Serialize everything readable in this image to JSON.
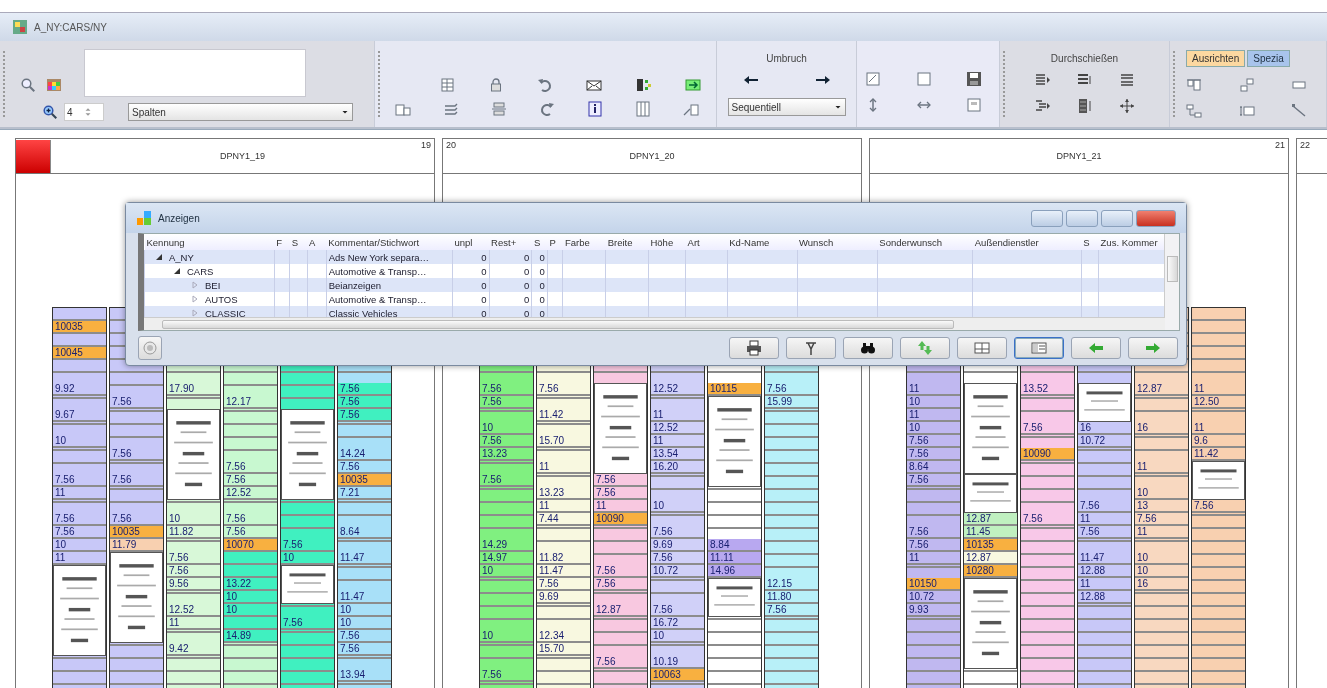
{
  "window": {
    "title": "A_NY:CARS/NY"
  },
  "ribbon": {
    "zoom_value": "4",
    "view_select": "Spalten",
    "break_label": "Umbruch",
    "break_select": "Sequentiell",
    "interleave_label": "Durchschießen",
    "tabs": [
      {
        "label": "Ausrichten",
        "selected": true
      },
      {
        "label": "Spezia",
        "selected": false
      }
    ]
  },
  "pages": [
    {
      "title": "DPNY1_19",
      "number": "19",
      "flagged": true,
      "columns": [
        {
          "color": "#c8c8f8",
          "head": [
            {
              "kind": "strip"
            },
            {
              "kind": "strip",
              "color": "#f8b040",
              "label": "10035"
            },
            {
              "kind": "strip"
            },
            {
              "kind": "strip",
              "color": "#f8b040",
              "label": "10045"
            },
            {
              "kind": "strip"
            }
          ],
          "blocks": [
            {
              "kind": "strip",
              "label": "9.92"
            },
            {
              "kind": "strip"
            },
            {
              "kind": "strip",
              "label": "9.67"
            },
            {
              "kind": "strip"
            },
            {
              "kind": "strip",
              "label": "10"
            },
            {
              "kind": "strip"
            },
            {
              "kind": "strip"
            },
            {
              "kind": "strip",
              "label": "7.56"
            },
            {
              "kind": "strip",
              "label": "11"
            },
            {
              "kind": "strip"
            },
            {
              "kind": "strip",
              "label": "7.56"
            },
            {
              "kind": "strip",
              "label": "7.56"
            },
            {
              "kind": "strip",
              "label": "10"
            },
            {
              "kind": "strip",
              "label": "11"
            },
            {
              "kind": "ad"
            }
          ]
        },
        {
          "color": "#c8c8f8",
          "blocks": [
            {
              "kind": "strip"
            },
            {
              "kind": "strip",
              "label": "7.56"
            },
            {
              "kind": "strip"
            },
            {
              "kind": "strip"
            },
            {
              "kind": "strip"
            },
            {
              "kind": "strip",
              "label": "7.56"
            },
            {
              "kind": "strip"
            },
            {
              "kind": "strip",
              "label": "7.56"
            },
            {
              "kind": "strip"
            },
            {
              "kind": "strip"
            },
            {
              "kind": "strip",
              "label": "7.56"
            },
            {
              "kind": "strip",
              "color": "#f8b040",
              "label": "10035"
            },
            {
              "kind": "strip",
              "color": "#f8d0b0",
              "label": "11.79"
            },
            {
              "kind": "ad"
            }
          ]
        },
        {
          "color": "#d8f8d8",
          "blocks": [
            {
              "kind": "strip",
              "label": "17.90"
            },
            {
              "kind": "strip"
            },
            {
              "kind": "ad"
            },
            {
              "kind": "strip"
            },
            {
              "kind": "strip",
              "label": "10"
            },
            {
              "kind": "strip",
              "label": "11.82"
            },
            {
              "kind": "strip"
            },
            {
              "kind": "strip",
              "label": "7.56"
            },
            {
              "kind": "strip",
              "label": "7.56"
            },
            {
              "kind": "strip",
              "label": "9.56"
            },
            {
              "kind": "strip"
            },
            {
              "kind": "strip",
              "label": "12.52"
            },
            {
              "kind": "strip",
              "label": "11"
            },
            {
              "kind": "strip"
            },
            {
              "kind": "strip",
              "label": "9.42"
            }
          ]
        },
        {
          "color": "#c8f8d0",
          "blocks": [
            {
              "kind": "strip"
            },
            {
              "kind": "strip",
              "label": "12.17"
            },
            {
              "kind": "strip"
            },
            {
              "kind": "strip"
            },
            {
              "kind": "strip"
            },
            {
              "kind": "strip"
            },
            {
              "kind": "strip",
              "label": "7.56"
            },
            {
              "kind": "strip",
              "label": "7.56"
            },
            {
              "kind": "strip",
              "label": "12.52"
            },
            {
              "kind": "strip"
            },
            {
              "kind": "strip",
              "label": "7.56"
            },
            {
              "kind": "strip",
              "label": "7.56"
            },
            {
              "kind": "strip",
              "color": "#f8b040",
              "label": "10070"
            },
            {
              "kind": "strip",
              "color": "#40f0c0"
            },
            {
              "kind": "strip",
              "color": "#40f0c0"
            },
            {
              "kind": "strip",
              "color": "#40f0c0",
              "label": "13.22"
            },
            {
              "kind": "strip",
              "color": "#40f0c0",
              "label": "10"
            },
            {
              "kind": "strip",
              "color": "#40f0c0",
              "label": "10"
            },
            {
              "kind": "strip",
              "color": "#40f0c0"
            },
            {
              "kind": "strip",
              "color": "#40f0c0",
              "label": "14.89"
            }
          ]
        },
        {
          "color": "#40f0c0",
          "blocks": [
            {
              "kind": "strip"
            },
            {
              "kind": "strip"
            },
            {
              "kind": "ad"
            },
            {
              "kind": "strip"
            },
            {
              "kind": "strip"
            },
            {
              "kind": "strip"
            },
            {
              "kind": "strip",
              "label": "7.56"
            },
            {
              "kind": "strip",
              "label": "10"
            },
            {
              "kind": "note"
            },
            {
              "kind": "strip"
            },
            {
              "kind": "strip",
              "label": "7.56"
            },
            {
              "kind": "strip"
            }
          ]
        },
        {
          "color": "#a8e0f8",
          "blocks": [
            {
              "kind": "strip",
              "color": "#40f0c0",
              "label": "7.56"
            },
            {
              "kind": "strip",
              "color": "#40f0c0",
              "label": "7.56"
            },
            {
              "kind": "strip",
              "color": "#40f0c0",
              "label": "7.56"
            },
            {
              "kind": "strip"
            },
            {
              "kind": "strip"
            },
            {
              "kind": "strip",
              "label": "14.24"
            },
            {
              "kind": "strip",
              "label": "7.56"
            },
            {
              "kind": "strip",
              "color": "#f8b040",
              "label": "10035"
            },
            {
              "kind": "strip",
              "label": "7.21"
            },
            {
              "kind": "strip"
            },
            {
              "kind": "strip"
            },
            {
              "kind": "strip",
              "label": "8.64"
            },
            {
              "kind": "strip"
            },
            {
              "kind": "strip",
              "label": "11.47"
            },
            {
              "kind": "strip"
            },
            {
              "kind": "strip"
            },
            {
              "kind": "strip",
              "label": "11.47"
            },
            {
              "kind": "strip",
              "label": "10"
            },
            {
              "kind": "strip",
              "label": "10"
            },
            {
              "kind": "strip",
              "label": "7.56"
            },
            {
              "kind": "strip",
              "label": "7.56"
            },
            {
              "kind": "strip"
            },
            {
              "kind": "strip",
              "label": "13.94"
            }
          ]
        }
      ]
    },
    {
      "title": "DPNY1_20",
      "number": "20",
      "flagged": false,
      "columns": [
        {
          "color": "#80f080",
          "blocks": [
            {
              "kind": "strip",
              "label": "7.56"
            },
            {
              "kind": "strip",
              "label": "7.56"
            },
            {
              "kind": "strip"
            },
            {
              "kind": "strip",
              "label": "10"
            },
            {
              "kind": "strip",
              "label": "7.56"
            },
            {
              "kind": "strip",
              "label": "13.23"
            },
            {
              "kind": "strip"
            },
            {
              "kind": "strip",
              "label": "7.56"
            },
            {
              "kind": "strip"
            },
            {
              "kind": "strip"
            },
            {
              "kind": "strip"
            },
            {
              "kind": "strip"
            },
            {
              "kind": "strip",
              "label": "14.29"
            },
            {
              "kind": "strip",
              "label": "14.97"
            },
            {
              "kind": "strip",
              "label": "10"
            },
            {
              "kind": "strip"
            },
            {
              "kind": "strip"
            },
            {
              "kind": "strip"
            },
            {
              "kind": "strip"
            },
            {
              "kind": "strip",
              "label": "10"
            },
            {
              "kind": "strip"
            },
            {
              "kind": "strip"
            },
            {
              "kind": "strip",
              "label": "7.56"
            }
          ]
        },
        {
          "color": "#f8f8e0",
          "blocks": [
            {
              "kind": "strip",
              "label": "7.56"
            },
            {
              "kind": "strip"
            },
            {
              "kind": "strip",
              "label": "11.42"
            },
            {
              "kind": "strip"
            },
            {
              "kind": "strip",
              "label": "15.70"
            },
            {
              "kind": "strip"
            },
            {
              "kind": "strip",
              "label": "11"
            },
            {
              "kind": "strip"
            },
            {
              "kind": "strip",
              "label": "13.23"
            },
            {
              "kind": "strip",
              "label": "11"
            },
            {
              "kind": "strip",
              "label": "7.44"
            },
            {
              "kind": "strip"
            },
            {
              "kind": "strip"
            },
            {
              "kind": "strip",
              "label": "11.82"
            },
            {
              "kind": "strip",
              "label": "11.47"
            },
            {
              "kind": "strip",
              "label": "7.56"
            },
            {
              "kind": "strip",
              "label": "9.69"
            },
            {
              "kind": "strip"
            },
            {
              "kind": "strip"
            },
            {
              "kind": "strip",
              "label": "12.34"
            },
            {
              "kind": "strip",
              "label": "15.70"
            }
          ]
        },
        {
          "color": "#f8c8e0",
          "blocks": [
            {
              "kind": "ad"
            },
            {
              "kind": "strip",
              "label": "7.56"
            },
            {
              "kind": "strip",
              "label": "7.56"
            },
            {
              "kind": "strip",
              "label": "11"
            },
            {
              "kind": "strip",
              "color": "#f8b040",
              "label": "10090"
            },
            {
              "kind": "strip"
            },
            {
              "kind": "strip"
            },
            {
              "kind": "strip"
            },
            {
              "kind": "strip",
              "label": "7.56"
            },
            {
              "kind": "strip",
              "label": "7.56"
            },
            {
              "kind": "strip"
            },
            {
              "kind": "strip",
              "label": "12.87"
            },
            {
              "kind": "strip"
            },
            {
              "kind": "strip"
            },
            {
              "kind": "strip"
            },
            {
              "kind": "strip",
              "label": "7.56"
            }
          ]
        },
        {
          "color": "#d0d0f8",
          "blocks": [
            {
              "kind": "strip",
              "label": "12.52"
            },
            {
              "kind": "strip"
            },
            {
              "kind": "strip",
              "label": "11"
            },
            {
              "kind": "strip",
              "label": "12.52"
            },
            {
              "kind": "strip",
              "label": "11"
            },
            {
              "kind": "strip",
              "label": "13.54"
            },
            {
              "kind": "strip",
              "label": "16.20"
            },
            {
              "kind": "strip"
            },
            {
              "kind": "strip"
            },
            {
              "kind": "strip",
              "label": "10"
            },
            {
              "kind": "strip"
            },
            {
              "kind": "strip",
              "label": "7.56"
            },
            {
              "kind": "strip",
              "label": "9.69"
            },
            {
              "kind": "strip",
              "label": "7.56"
            },
            {
              "kind": "strip",
              "label": "10.72"
            },
            {
              "kind": "strip"
            },
            {
              "kind": "strip"
            },
            {
              "kind": "strip",
              "label": "7.56"
            },
            {
              "kind": "strip",
              "label": "16.72"
            },
            {
              "kind": "strip",
              "label": "10"
            },
            {
              "kind": "strip"
            },
            {
              "kind": "strip",
              "label": "10.19"
            },
            {
              "kind": "strip",
              "color": "#f8b040",
              "label": "10063"
            }
          ]
        },
        {
          "color": "#ffffff",
          "blocks": [
            {
              "kind": "strip",
              "color": "#f8b040",
              "label": "10115"
            },
            {
              "kind": "ad"
            },
            {
              "kind": "strip"
            },
            {
              "kind": "strip"
            },
            {
              "kind": "strip"
            },
            {
              "kind": "strip"
            },
            {
              "kind": "strip",
              "color": "#b8a8f0",
              "label": "8.84"
            },
            {
              "kind": "strip",
              "color": "#b8a8f0",
              "label": "11.11"
            },
            {
              "kind": "strip",
              "color": "#b8a8f0",
              "label": "14.96"
            },
            {
              "kind": "note"
            }
          ]
        },
        {
          "color": "#b8f0f8",
          "blocks": [
            {
              "kind": "strip",
              "label": "7.56"
            },
            {
              "kind": "strip",
              "label": "15.99"
            },
            {
              "kind": "strip"
            },
            {
              "kind": "strip"
            },
            {
              "kind": "strip"
            },
            {
              "kind": "strip"
            },
            {
              "kind": "strip"
            },
            {
              "kind": "strip"
            },
            {
              "kind": "strip"
            },
            {
              "kind": "strip"
            },
            {
              "kind": "strip"
            },
            {
              "kind": "strip"
            },
            {
              "kind": "strip"
            },
            {
              "kind": "strip"
            },
            {
              "kind": "strip"
            },
            {
              "kind": "strip",
              "label": "12.15"
            },
            {
              "kind": "strip",
              "label": "11.80"
            },
            {
              "kind": "strip",
              "label": "7.56"
            }
          ]
        }
      ]
    },
    {
      "title": "DPNY1_21",
      "number": "21",
      "flagged": false,
      "columns": [
        {
          "color": "#c0b8f0",
          "blocks": [
            {
              "kind": "strip",
              "label": "11"
            },
            {
              "kind": "strip",
              "label": "10"
            },
            {
              "kind": "strip",
              "label": "11"
            },
            {
              "kind": "strip",
              "label": "10"
            },
            {
              "kind": "strip",
              "label": "7.56"
            },
            {
              "kind": "strip",
              "label": "7.56"
            },
            {
              "kind": "strip",
              "label": "8.64"
            },
            {
              "kind": "strip",
              "label": "7.56"
            },
            {
              "kind": "strip"
            },
            {
              "kind": "strip"
            },
            {
              "kind": "strip"
            },
            {
              "kind": "strip",
              "label": "7.56"
            },
            {
              "kind": "strip",
              "label": "7.56"
            },
            {
              "kind": "strip",
              "label": "11"
            },
            {
              "kind": "strip"
            },
            {
              "kind": "strip",
              "color": "#f8b040",
              "label": "10150"
            },
            {
              "kind": "strip",
              "label": "10.72"
            },
            {
              "kind": "strip",
              "label": "9.93"
            }
          ]
        },
        {
          "color": "#ffffff",
          "blocks": [
            {
              "kind": "ad"
            },
            {
              "kind": "note"
            },
            {
              "kind": "strip",
              "color": "#c0f0c0",
              "label": "12.87"
            },
            {
              "kind": "strip",
              "color": "#c0f0c0",
              "label": "11.45"
            },
            {
              "kind": "strip",
              "color": "#f8b040",
              "label": "10135"
            },
            {
              "kind": "strip",
              "color": "#f8f8e0",
              "label": "12.87"
            },
            {
              "kind": "strip",
              "color": "#f8b040",
              "label": "10280"
            },
            {
              "kind": "ad"
            }
          ]
        },
        {
          "color": "#f8c8e8",
          "blocks": [
            {
              "kind": "strip",
              "label": "13.52"
            },
            {
              "kind": "strip"
            },
            {
              "kind": "strip"
            },
            {
              "kind": "strip",
              "label": "7.56"
            },
            {
              "kind": "strip"
            },
            {
              "kind": "strip",
              "color": "#f8b040",
              "label": "10090"
            },
            {
              "kind": "strip"
            },
            {
              "kind": "strip"
            },
            {
              "kind": "strip"
            },
            {
              "kind": "strip"
            },
            {
              "kind": "strip",
              "label": "7.56"
            },
            {
              "kind": "strip"
            },
            {
              "kind": "strip"
            },
            {
              "kind": "strip"
            }
          ]
        },
        {
          "color": "#c8c8f8",
          "blocks": [
            {
              "kind": "note"
            },
            {
              "kind": "strip",
              "label": "16"
            },
            {
              "kind": "strip",
              "label": "10.72"
            },
            {
              "kind": "strip"
            },
            {
              "kind": "strip"
            },
            {
              "kind": "strip"
            },
            {
              "kind": "strip"
            },
            {
              "kind": "strip",
              "label": "7.56"
            },
            {
              "kind": "strip",
              "label": "11"
            },
            {
              "kind": "strip",
              "label": "7.56"
            },
            {
              "kind": "strip"
            },
            {
              "kind": "strip",
              "label": "11.47"
            },
            {
              "kind": "strip",
              "label": "12.88"
            },
            {
              "kind": "strip",
              "label": "11"
            },
            {
              "kind": "strip",
              "label": "12.88"
            }
          ]
        },
        {
          "color": "#f8d8c0",
          "blocks": [
            {
              "kind": "strip",
              "label": "12.87"
            },
            {
              "kind": "strip"
            },
            {
              "kind": "strip"
            },
            {
              "kind": "strip",
              "label": "16"
            },
            {
              "kind": "strip"
            },
            {
              "kind": "strip"
            },
            {
              "kind": "strip",
              "label": "11"
            },
            {
              "kind": "strip"
            },
            {
              "kind": "strip",
              "label": "10"
            },
            {
              "kind": "strip",
              "label": "13"
            },
            {
              "kind": "strip",
              "label": "7.56"
            },
            {
              "kind": "strip",
              "label": "11"
            },
            {
              "kind": "strip"
            },
            {
              "kind": "strip",
              "label": "10"
            },
            {
              "kind": "strip",
              "label": "10"
            },
            {
              "kind": "strip",
              "label": "16"
            }
          ]
        },
        {
          "color": "#f8d0b0",
          "blocks": [
            {
              "kind": "strip",
              "label": "11"
            },
            {
              "kind": "strip",
              "label": "12.50"
            },
            {
              "kind": "strip"
            },
            {
              "kind": "strip",
              "label": "11"
            },
            {
              "kind": "strip",
              "label": "9.6"
            },
            {
              "kind": "strip",
              "label": "11.42"
            },
            {
              "kind": "note"
            },
            {
              "kind": "strip",
              "label": "7.56"
            }
          ]
        }
      ]
    },
    {
      "number": "22",
      "flagged": false
    }
  ],
  "dialog": {
    "title": "Anzeigen",
    "columns": [
      "Kennung",
      "F",
      "S",
      "A",
      "Kommentar/Stichwort",
      "unpl",
      "Rest+",
      "S",
      "P",
      "Farbe",
      "Breite",
      "Höhe",
      "Art",
      "Kd-Name",
      "Wunsch",
      "Sonderwunsch",
      "Außendienstler",
      "S",
      "Zus. Kommer"
    ],
    "tree": [
      {
        "name": "A_NY",
        "comment": "Ads New York separa…",
        "unpl": "0",
        "rest": "0",
        "s": "0",
        "expanded": true,
        "children": [
          {
            "name": "CARS",
            "comment": "Automotive & Transp…",
            "unpl": "0",
            "rest": "0",
            "s": "0",
            "expanded": true,
            "children": [
              {
                "name": "BEI",
                "comment": "Beianzeigen",
                "unpl": "0",
                "rest": "0",
                "s": "0",
                "expanded": false
              },
              {
                "name": "AUTOS",
                "comment": "Automotive & Transp…",
                "unpl": "0",
                "rest": "0",
                "s": "0",
                "expanded": false
              },
              {
                "name": "CLASSIC",
                "comment": "Classic Vehicles",
                "unpl": "0",
                "rest": "0",
                "s": "0",
                "expanded": false
              }
            ]
          }
        ]
      }
    ]
  }
}
